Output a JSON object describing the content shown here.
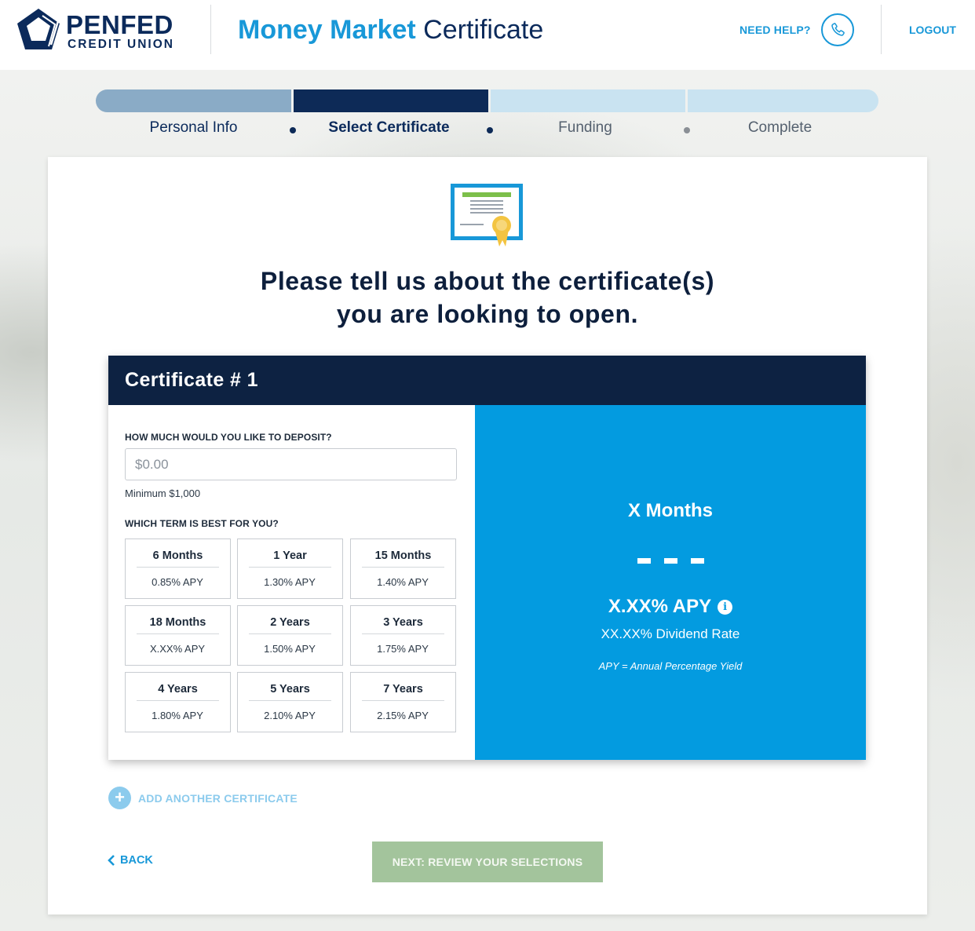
{
  "header": {
    "logo_name": "PENFED",
    "logo_sub": "CREDIT UNION",
    "title_accent": "Money Market",
    "title_rest": " Certificate",
    "need_help": "NEED HELP?",
    "phone_icon": "phone-icon",
    "logout": "LOGOUT"
  },
  "steps": [
    {
      "label": "Personal Info",
      "state": "done"
    },
    {
      "label": "Select Certificate",
      "state": "active"
    },
    {
      "label": "Funding",
      "state": "upcoming"
    },
    {
      "label": "Complete",
      "state": "upcoming"
    }
  ],
  "headline_line1": "Please tell us about the certificate(s)",
  "headline_line2": "you are looking to open.",
  "certificate": {
    "title": "Certificate # 1",
    "deposit_label": "HOW MUCH WOULD YOU LIKE TO DEPOSIT?",
    "deposit_value": "",
    "deposit_placeholder": "$0.00",
    "minimum_note": "Minimum $1,000",
    "term_label": "WHICH TERM IS BEST FOR YOU?",
    "terms": [
      {
        "name": "6 Months",
        "apy": "0.85% APY"
      },
      {
        "name": "1 Year",
        "apy": "1.30% APY"
      },
      {
        "name": "15 Months",
        "apy": "1.40% APY"
      },
      {
        "name": "18 Months",
        "apy": "X.XX% APY"
      },
      {
        "name": "2 Years",
        "apy": "1.50% APY"
      },
      {
        "name": "3 Years",
        "apy": "1.75% APY"
      },
      {
        "name": "4 Years",
        "apy": "1.80% APY"
      },
      {
        "name": "5 Years",
        "apy": "2.10% APY"
      },
      {
        "name": "7 Years",
        "apy": "2.15% APY"
      }
    ]
  },
  "summary": {
    "term": "X Months",
    "apy": "X.XX% APY",
    "info_icon": "info-icon",
    "dividend_rate": "XX.XX% Dividend Rate",
    "apy_note": "APY = Annual Percentage Yield"
  },
  "actions": {
    "add_icon": "plus-icon",
    "add_label": "ADD ANOTHER CERTIFICATE",
    "back_icon": "chevron-left-icon",
    "back_label": "BACK",
    "next_label": "NEXT: REVIEW YOUR SELECTIONS"
  },
  "colors": {
    "brand_navy": "#0b2a5b",
    "accent_blue": "#1898d8",
    "summary_blue": "#039be0",
    "header_dark": "#0d2242",
    "next_disabled": "#a3c49c"
  }
}
